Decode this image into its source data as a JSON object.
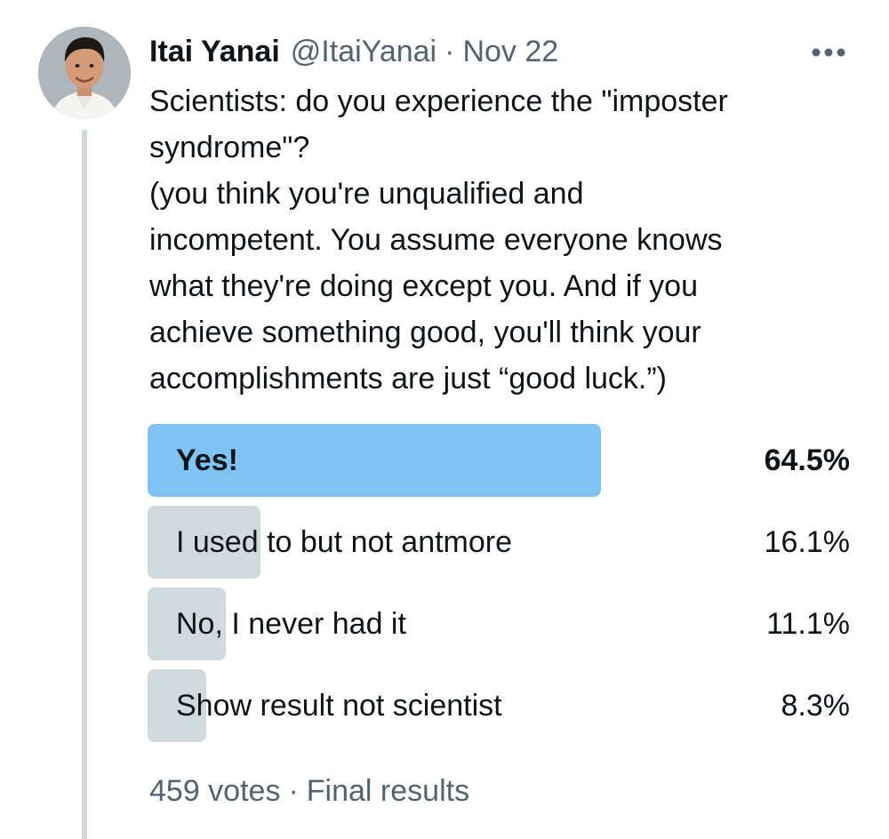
{
  "author": {
    "display_name": "Itai Yanai",
    "handle": "@ItaiYanai",
    "separator": "·",
    "date": "Nov 22",
    "avatar_icon": "profile-photo"
  },
  "more_icon": "more-horizontal-icon",
  "tweet": {
    "lines": [
      "Scientists: do you experience the \"imposter",
      "syndrome\"?",
      "(you think you're unqualified and",
      "incompetent. You assume everyone knows",
      "what they're doing except you. And if you",
      "achieve something good, you'll think your",
      "accomplishments are just “good luck.”)"
    ]
  },
  "poll": {
    "options": [
      {
        "label": "Yes!",
        "percent_text": "64.5%",
        "percent": 64.5,
        "winner": true
      },
      {
        "label": "I used to but not antmore",
        "percent_text": "16.1%",
        "percent": 16.1,
        "winner": false
      },
      {
        "label": "No, I never had it",
        "percent_text": "11.1%",
        "percent": 11.1,
        "winner": false
      },
      {
        "label": "Show result not scientist",
        "percent_text": "8.3%",
        "percent": 8.3,
        "winner": false
      }
    ],
    "votes_text": "459 votes",
    "separator": "·",
    "status_text": "Final results"
  },
  "colors": {
    "winner_bar": "#7ec3f4",
    "other_bar": "#cfd9de",
    "secondary_text": "#536471",
    "primary_text": "#0f1419"
  }
}
